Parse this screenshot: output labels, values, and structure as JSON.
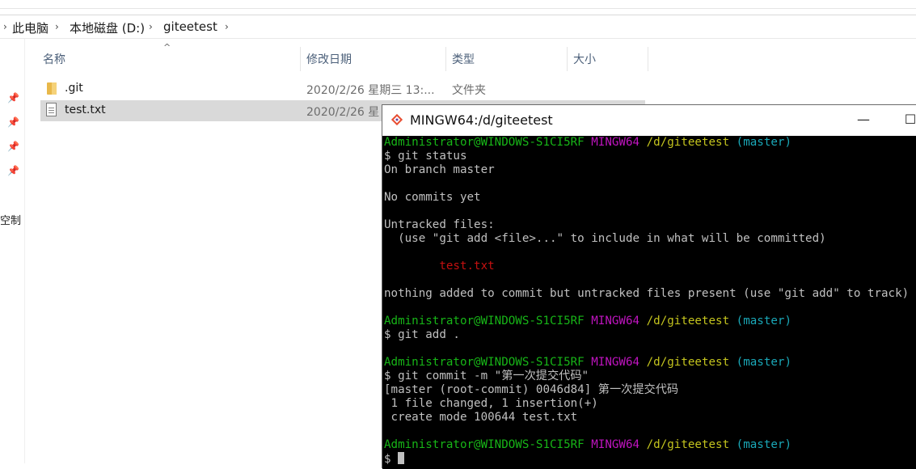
{
  "explorer": {
    "breadcrumb": [
      "此电脑",
      "本地磁盘 (D:)",
      "giteetest"
    ],
    "nav_label": "空制",
    "columns": {
      "name": "名称",
      "modified": "修改日期",
      "type": "类型",
      "size": "大小"
    },
    "files": [
      {
        "name": ".git",
        "modified": "2020/2/26 星期三 13:...",
        "type": "文件夹",
        "icon": "folder-icon"
      },
      {
        "name": "test.txt",
        "modified": "2020/2/26 星",
        "type": "",
        "icon": "text-file-icon",
        "selected": true
      }
    ]
  },
  "terminal": {
    "title": "MINGW64:/d/giteetest",
    "minimize": "—",
    "maximize": "☐",
    "prompt": {
      "user_host": "Administrator@WINDOWS-S1CI5RF",
      "env": "MINGW64",
      "path": "/d/giteetest",
      "branch": "(master)"
    },
    "lines": {
      "cmd1": "$ git status",
      "l2": "On branch master",
      "l4": "No commits yet",
      "l6": "Untracked files:",
      "l7": "  (use \"git add <file>...\" to include in what will be committed)",
      "l9": "        test.txt",
      "l11": "nothing added to commit but untracked files present (use \"git add\" to track)",
      "cmd2": "$ git add .",
      "cmd3": "$ git commit -m \"第一次提交代码\"",
      "l17": "[master (root-commit) 0046d84] 第一次提交代码",
      "l18": " 1 file changed, 1 insertion(+)",
      "l19": " create mode 100644 test.txt",
      "final_prompt": "$ "
    }
  }
}
